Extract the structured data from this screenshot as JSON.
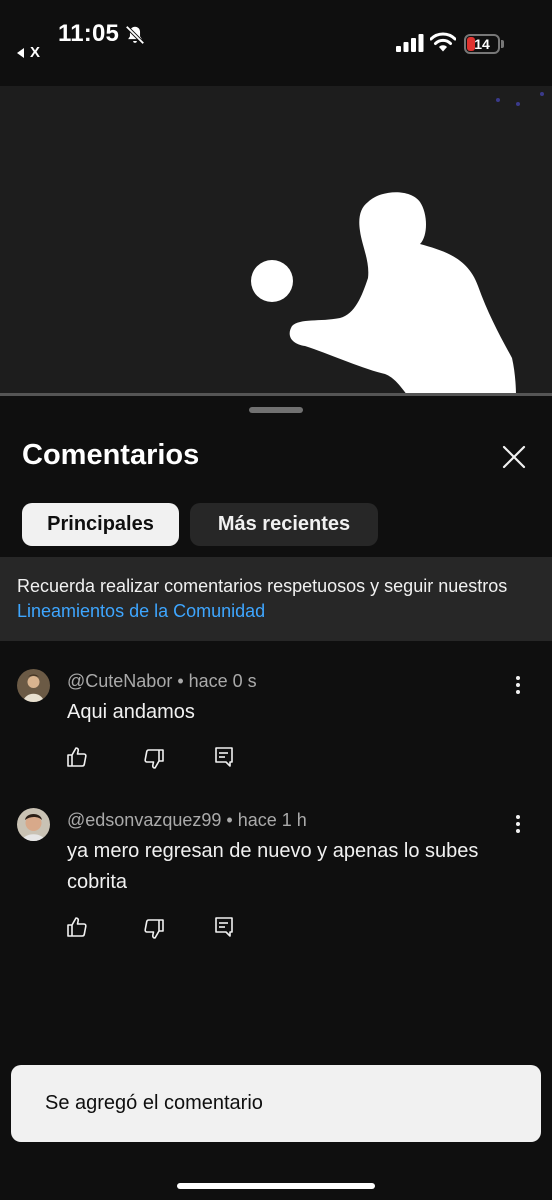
{
  "status_bar": {
    "time": "11:05",
    "back_app": "X",
    "battery": "14"
  },
  "sheet": {
    "title": "Comentarios",
    "tabs": [
      {
        "label": "Principales",
        "active": true
      },
      {
        "label": "Más recientes",
        "active": false
      }
    ],
    "notice": {
      "text": "Recuerda realizar comentarios respetuosos y seguir nuestros ",
      "link": "Lineamientos de la Comunidad"
    }
  },
  "comments": [
    {
      "author": "@CuteNabor",
      "time": "hace 0 s",
      "text": "Aqui andamos"
    },
    {
      "author": "@edsonvazquez99",
      "time": "hace 1 h",
      "text": "ya mero regresan de nuevo y apenas lo subes cobrita"
    }
  ],
  "meta_separator": " • ",
  "toast": "Se agregó el comentario",
  "colors": {
    "background": "#0f0f0f",
    "chip_active": "#f1f1f1",
    "chip_inactive": "#272727",
    "link": "#3ea6ff",
    "battery_low": "#e0332f"
  },
  "icons": [
    "bell-slash-icon",
    "signal-icon",
    "wifi-icon",
    "close-icon",
    "more-vert-icon",
    "like-icon",
    "dislike-icon",
    "reply-icon"
  ]
}
